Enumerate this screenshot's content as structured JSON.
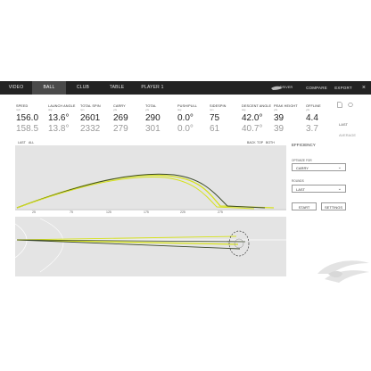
{
  "nav": {
    "tabs": [
      "VIDEO",
      "BALL",
      "CLUB",
      "TABLE",
      "PLAYER 1"
    ],
    "right": [
      "DRIVER",
      "COMPARE",
      "EXPORT"
    ],
    "close": "×"
  },
  "stats": [
    {
      "label": "SPEED",
      "unit": "mph",
      "last": "156.0",
      "avg": "158.5"
    },
    {
      "label": "LAUNCH ANGLE",
      "unit": "deg",
      "last": "13.6°",
      "avg": "13.8°"
    },
    {
      "label": "TOTAL SPIN",
      "unit": "rpm",
      "last": "2601",
      "avg": "2332"
    },
    {
      "label": "CARRY",
      "unit": "yds",
      "last": "269",
      "avg": "279"
    },
    {
      "label": "TOTAL",
      "unit": "yds",
      "last": "290",
      "avg": "301"
    },
    {
      "label": "PUSH/PULL",
      "unit": "deg",
      "last": "0.0°",
      "avg": "0.0°"
    },
    {
      "label": "SIDESPIN",
      "unit": "rpm",
      "last": "75",
      "avg": "61"
    },
    {
      "label": "DESCENT ANGLE",
      "unit": "deg",
      "last": "42.0°",
      "avg": "40.7°"
    },
    {
      "label": "PEAK HEIGHT",
      "unit": "yds",
      "last": "39",
      "avg": "39"
    },
    {
      "label": "OFFLINE",
      "unit": "yds",
      "last": "4.4",
      "avg": "3.7"
    }
  ],
  "row_labels": {
    "last": "LAST",
    "average": "AVERAGE"
  },
  "shot_toggle": {
    "last": "LAST",
    "all": "ALL"
  },
  "view_toggle": [
    "BACK",
    "TOP",
    "BOTH"
  ],
  "chart_ticks": [
    "25",
    "75",
    "125",
    "175",
    "225",
    "275"
  ],
  "panel": {
    "title": "EFFICIENCY",
    "optimize_label": "OPTIMIZE FOR",
    "optimize_value": "CARRY",
    "rounds_label": "ROUNDS",
    "rounds_value": "LAST",
    "start": "START",
    "settings": "SETTINGS"
  },
  "colors": {
    "yellow": "#d6e21c",
    "dark": "#3c4a2a",
    "bar": "#232323"
  }
}
